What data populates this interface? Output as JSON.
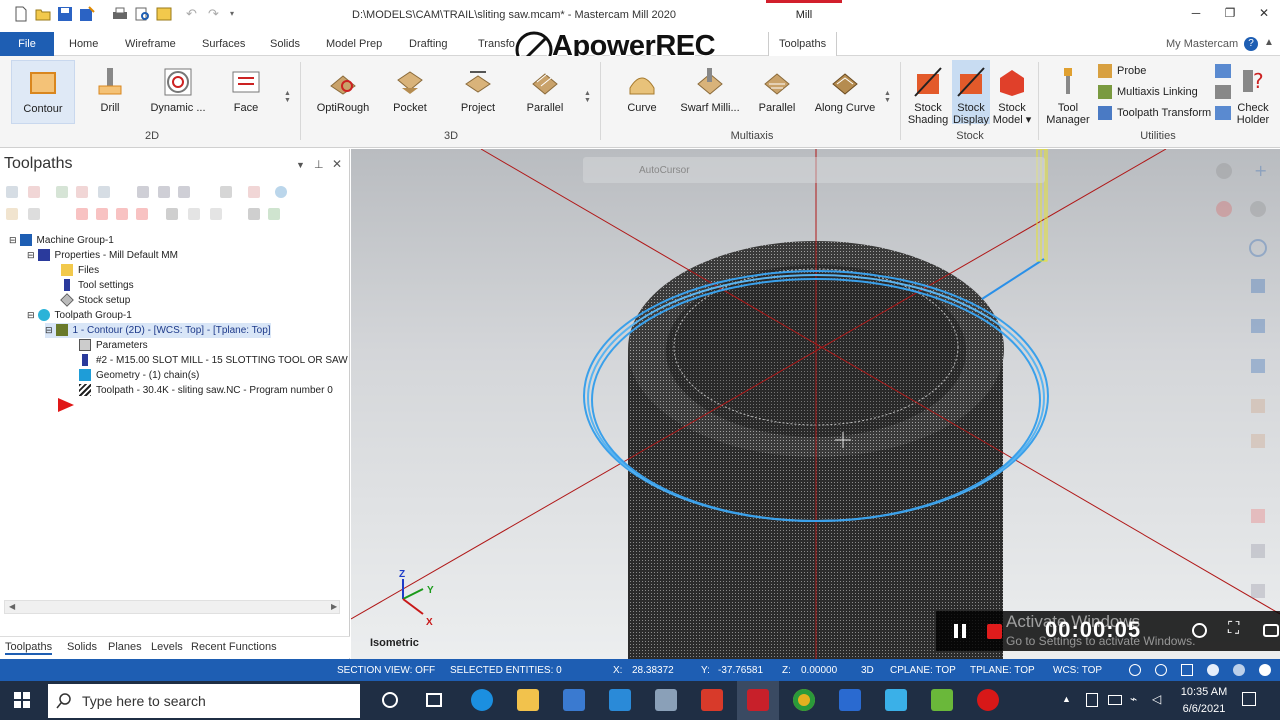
{
  "window": {
    "title": "D:\\MODELS\\CAM\\TRAIL\\sliting saw.mcam* - Mastercam Mill 2020",
    "context_tab": "Mill"
  },
  "ribbon_tabs": [
    {
      "label": "File"
    },
    {
      "label": "Home"
    },
    {
      "label": "Wireframe"
    },
    {
      "label": "Surfaces"
    },
    {
      "label": "Solids"
    },
    {
      "label": "Model Prep"
    },
    {
      "label": "Drafting"
    },
    {
      "label": "Transfo"
    },
    {
      "label": "Toolpaths"
    }
  ],
  "my_mastercam": "My Mastercam",
  "watermark": "ApowerREC",
  "ribbon": {
    "groups": {
      "g2d": "2D",
      "g3d": "3D",
      "multiaxis": "Multiaxis",
      "stock": "Stock",
      "utilities": "Utilities"
    },
    "buttons": {
      "contour": "Contour",
      "drill": "Drill",
      "dynamic": "Dynamic ...",
      "face": "Face",
      "optirough": "OptiRough",
      "pocket": "Pocket",
      "project": "Project",
      "parallel3d": "Parallel",
      "curve": "Curve",
      "swarf": "Swarf Milli...",
      "parallel_ma": "Parallel",
      "along_curve": "Along Curve",
      "stock_shading_1": "Stock",
      "stock_shading_2": "Shading",
      "stock_display_1": "Stock",
      "stock_display_2": "Display",
      "stock_model_1": "Stock",
      "stock_model_2": "Model ▾",
      "tool_manager_1": "Tool",
      "tool_manager_2": "Manager",
      "probe": "Probe",
      "multiaxis_linking": "Multiaxis Linking",
      "toolpath_transform": "Toolpath Transform",
      "check_holder_1": "Check",
      "check_holder_2": "Holder"
    }
  },
  "panel": {
    "title": "Toolpaths",
    "tree": [
      {
        "label": "Machine Group-1"
      },
      {
        "label": "Properties - Mill Default MM"
      },
      {
        "label": "Files"
      },
      {
        "label": "Tool settings"
      },
      {
        "label": "Stock setup"
      },
      {
        "label": "Toolpath Group-1"
      },
      {
        "label": "1 - Contour (2D) - [WCS: Top] - [Tplane: Top]"
      },
      {
        "label": "Parameters"
      },
      {
        "label": "#2 - M15.00 SLOT MILL - 15 SLOTTING TOOL OR SAW"
      },
      {
        "label": "Geometry - (1) chain(s)"
      },
      {
        "label": "Toolpath - 30.4K - sliting saw.NC - Program number 0"
      }
    ],
    "bottom_tabs": [
      "Toolpaths",
      "Solids",
      "Planes",
      "Levels",
      "Recent Functions"
    ]
  },
  "viewport": {
    "view_name": "Isometric",
    "axis_labels": {
      "z": "Z",
      "y": "Y",
      "x": "X"
    },
    "autocursor": "AutoCursor"
  },
  "recorder": {
    "time": "00:00:05",
    "activate_line1": "Activate Windows",
    "activate_line2": "Go to Settings to activate Windows."
  },
  "statusbar": {
    "section_view": "SECTION VIEW: OFF",
    "selected": "SELECTED ENTITIES: 0",
    "x_label": "X:",
    "x": "28.38372",
    "y_label": "Y:",
    "y": "-37.76581",
    "z_label": "Z:",
    "z": "0.00000",
    "mode": "3D",
    "cplane": "CPLANE: TOP",
    "tplane": "TPLANE: TOP",
    "wcs": "WCS: TOP"
  },
  "taskbar": {
    "search_placeholder": "Type here to search",
    "time": "10:35 AM",
    "date": "6/6/2021"
  },
  "colors": {
    "accent": "#1e5eb3",
    "mill_tab": "#d21f2c",
    "toolpath_blue": "#3aa0ea",
    "tool_yellow": "#e8e430"
  }
}
